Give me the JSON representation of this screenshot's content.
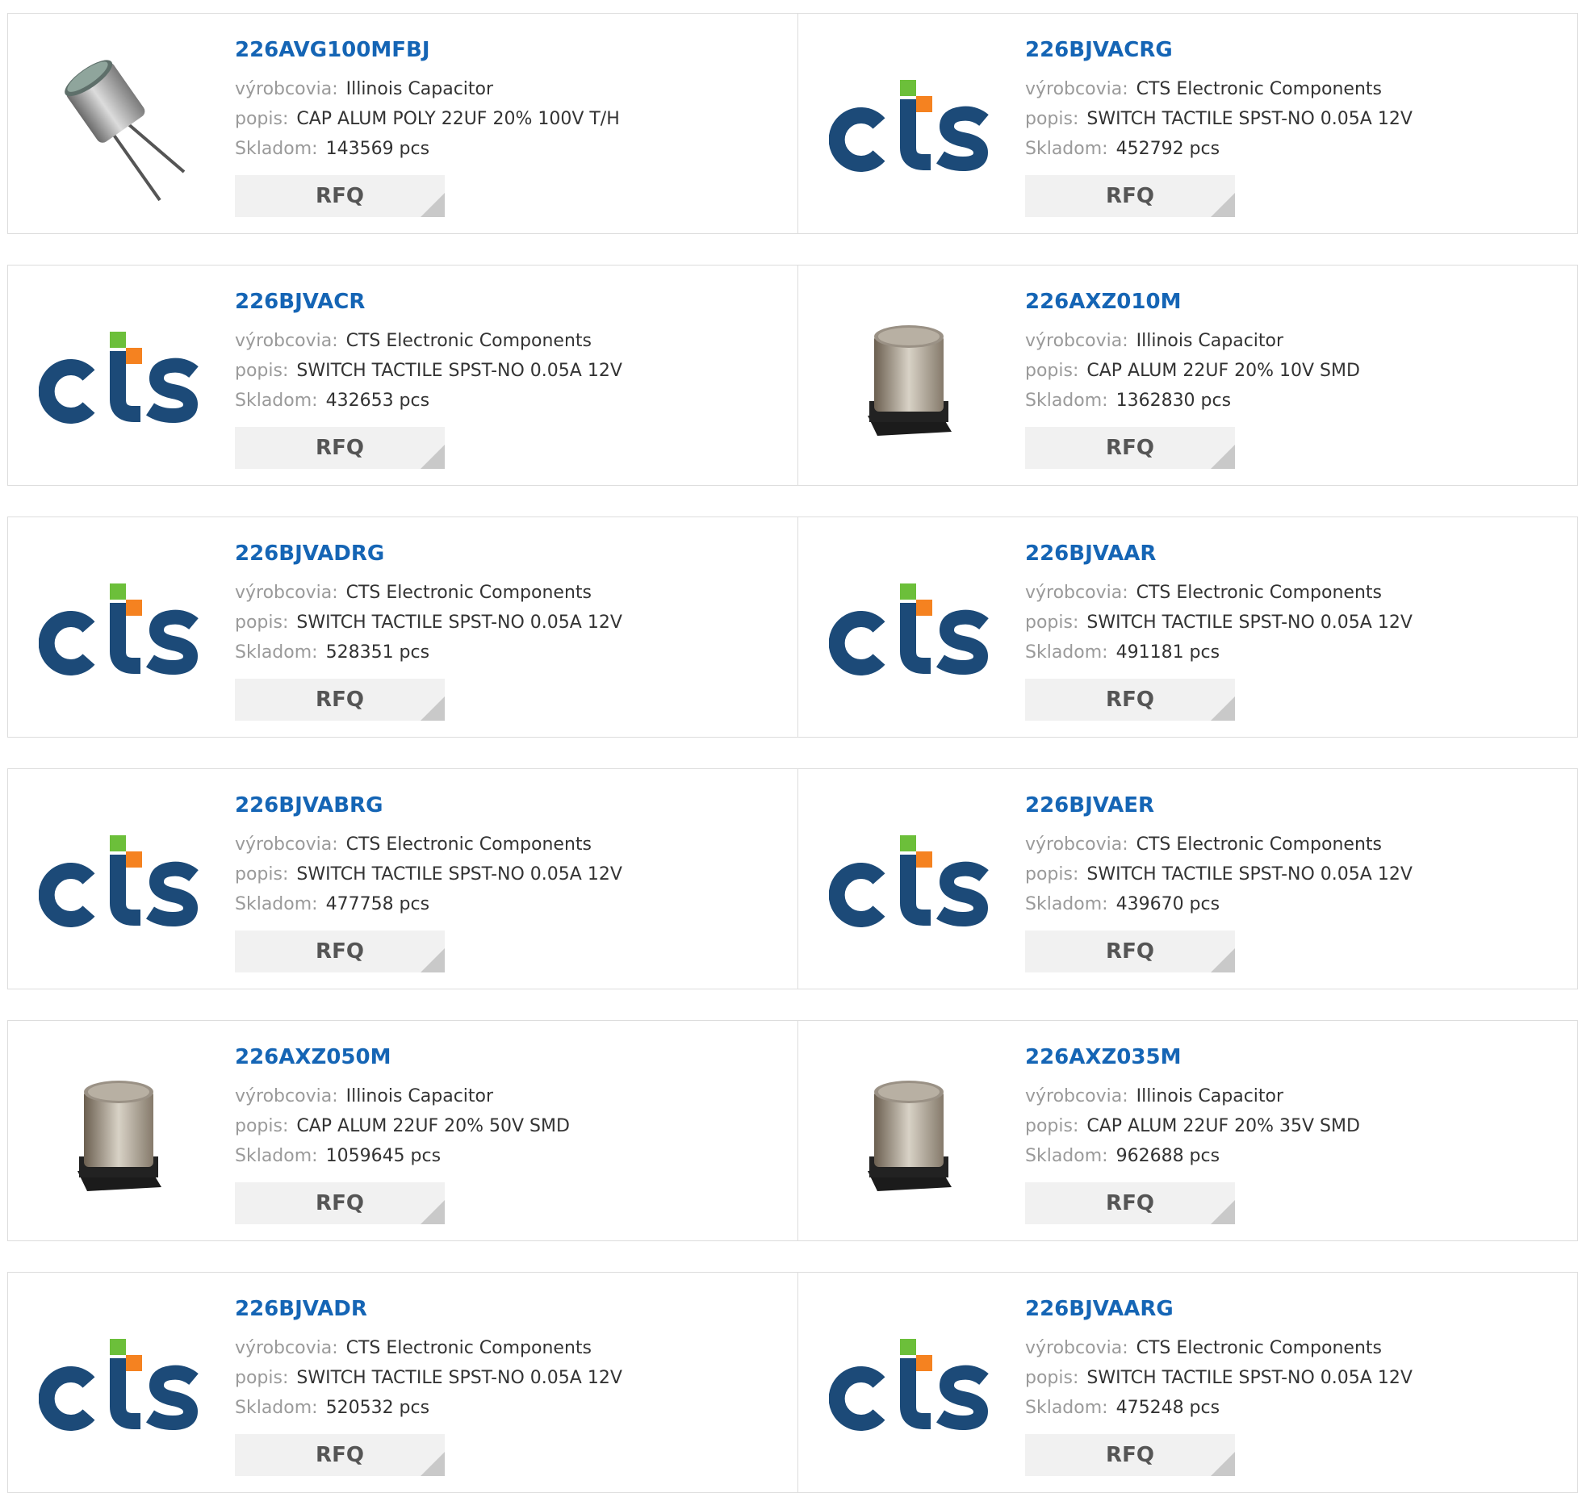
{
  "labels": {
    "manufacturer": "výrobcovia:",
    "description": "popis:",
    "stock": "Skladom:"
  },
  "rfq_label": "RFQ",
  "products": [
    {
      "part": "226AVG100MFBJ",
      "manufacturer": "Illinois Capacitor",
      "description": "CAP ALUM POLY 22UF 20% 100V T/H",
      "stock": "143569 pcs",
      "image": "through-hole-capacitor"
    },
    {
      "part": "226BJVACRG",
      "manufacturer": "CTS Electronic Components",
      "description": "SWITCH TACTILE SPST-NO 0.05A 12V",
      "stock": "452792 pcs",
      "image": "cts-logo"
    },
    {
      "part": "226BJVACR",
      "manufacturer": "CTS Electronic Components",
      "description": "SWITCH TACTILE SPST-NO 0.05A 12V",
      "stock": "432653 pcs",
      "image": "cts-logo"
    },
    {
      "part": "226AXZ010M",
      "manufacturer": "Illinois Capacitor",
      "description": "CAP ALUM 22UF 20% 10V SMD",
      "stock": "1362830 pcs",
      "image": "smd-capacitor"
    },
    {
      "part": "226BJVADRG",
      "manufacturer": "CTS Electronic Components",
      "description": "SWITCH TACTILE SPST-NO 0.05A 12V",
      "stock": "528351 pcs",
      "image": "cts-logo"
    },
    {
      "part": "226BJVAAR",
      "manufacturer": "CTS Electronic Components",
      "description": "SWITCH TACTILE SPST-NO 0.05A 12V",
      "stock": "491181 pcs",
      "image": "cts-logo"
    },
    {
      "part": "226BJVABRG",
      "manufacturer": "CTS Electronic Components",
      "description": "SWITCH TACTILE SPST-NO 0.05A 12V",
      "stock": "477758 pcs",
      "image": "cts-logo"
    },
    {
      "part": "226BJVAER",
      "manufacturer": "CTS Electronic Components",
      "description": "SWITCH TACTILE SPST-NO 0.05A 12V",
      "stock": "439670 pcs",
      "image": "cts-logo"
    },
    {
      "part": "226AXZ050M",
      "manufacturer": "Illinois Capacitor",
      "description": "CAP ALUM 22UF 20% 50V SMD",
      "stock": "1059645 pcs",
      "image": "smd-capacitor"
    },
    {
      "part": "226AXZ035M",
      "manufacturer": "Illinois Capacitor",
      "description": "CAP ALUM 22UF 20% 35V SMD",
      "stock": "962688 pcs",
      "image": "smd-capacitor"
    },
    {
      "part": "226BJVADR",
      "manufacturer": "CTS Electronic Components",
      "description": "SWITCH TACTILE SPST-NO 0.05A 12V",
      "stock": "520532 pcs",
      "image": "cts-logo"
    },
    {
      "part": "226BJVAARG",
      "manufacturer": "CTS Electronic Components",
      "description": "SWITCH TACTILE SPST-NO 0.05A 12V",
      "stock": "475248 pcs",
      "image": "cts-logo"
    }
  ],
  "colors": {
    "part_link": "#1565b5",
    "label": "#9a9a9a",
    "cts_navy": "#1c4a78",
    "cts_green": "#6cbf3a",
    "cts_orange": "#f58220"
  }
}
